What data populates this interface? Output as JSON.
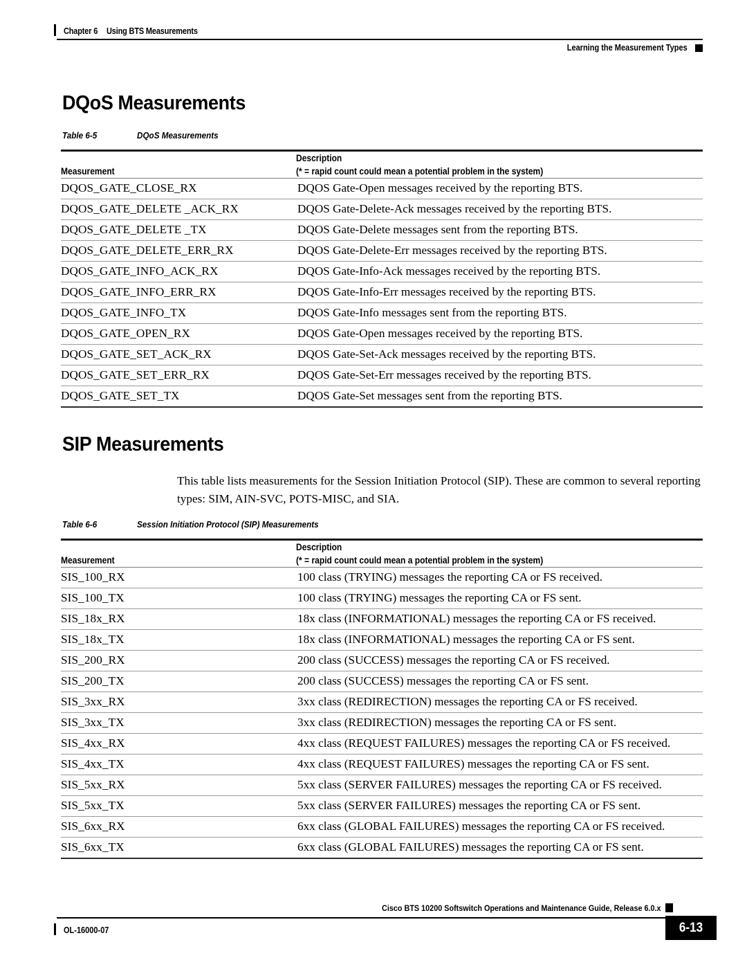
{
  "header": {
    "chapter_label": "Chapter 6",
    "chapter_title": "Using BTS Measurements",
    "right_text": "Learning the Measurement Types"
  },
  "sections": {
    "dqos": {
      "heading": "DQoS Measurements",
      "table": {
        "caption_number": "Table 6-5",
        "caption_title": "DQoS Measurements",
        "columns": {
          "measurement": "Measurement",
          "description_line1": "Description",
          "description_line2": "(* = rapid count could mean a potential problem in the system)"
        },
        "rows": [
          {
            "measurement": "DQOS_GATE_CLOSE_RX",
            "description": "DQOS Gate-Open messages received by the reporting BTS."
          },
          {
            "measurement": "DQOS_GATE_DELETE _ACK_RX",
            "description": "DQOS Gate-Delete-Ack messages received by the reporting BTS."
          },
          {
            "measurement": "DQOS_GATE_DELETE _TX",
            "description": "DQOS Gate-Delete messages sent from the reporting BTS."
          },
          {
            "measurement": "DQOS_GATE_DELETE_ERR_RX",
            "description": "DQOS Gate-Delete-Err messages received by the reporting BTS."
          },
          {
            "measurement": "DQOS_GATE_INFO_ACK_RX",
            "description": "DQOS Gate-Info-Ack messages received by the reporting BTS."
          },
          {
            "measurement": "DQOS_GATE_INFO_ERR_RX",
            "description": "DQOS Gate-Info-Err messages received by the reporting BTS."
          },
          {
            "measurement": "DQOS_GATE_INFO_TX",
            "description": "DQOS Gate-Info messages sent from the reporting BTS."
          },
          {
            "measurement": "DQOS_GATE_OPEN_RX",
            "description": "DQOS Gate-Open messages received by the reporting BTS."
          },
          {
            "measurement": "DQOS_GATE_SET_ACK_RX",
            "description": "DQOS Gate-Set-Ack messages received by the reporting BTS."
          },
          {
            "measurement": "DQOS_GATE_SET_ERR_RX",
            "description": "DQOS Gate-Set-Err messages received by the reporting BTS."
          },
          {
            "measurement": "DQOS_GATE_SET_TX",
            "description": "DQOS Gate-Set messages sent from the reporting BTS."
          }
        ]
      }
    },
    "sip": {
      "heading": "SIP Measurements",
      "intro": "This table lists measurements for the Session Initiation Protocol (SIP). These are common to several reporting types: SIM, AIN-SVC, POTS-MISC, and SIA.",
      "table": {
        "caption_number": "Table 6-6",
        "caption_title": "Session Initiation Protocol (SIP) Measurements",
        "columns": {
          "measurement": "Measurement",
          "description_line1": "Description",
          "description_line2": "(* = rapid count could mean a potential problem in the system)"
        },
        "rows": [
          {
            "measurement": "SIS_100_RX",
            "description": "100 class (TRYING) messages the reporting CA or FS received."
          },
          {
            "measurement": "SIS_100_TX",
            "description": "100 class (TRYING) messages the reporting CA or FS sent."
          },
          {
            "measurement": "SIS_18x_RX",
            "description": "18x class (INFORMATIONAL) messages the reporting CA or FS received."
          },
          {
            "measurement": "SIS_18x_TX",
            "description": "18x class (INFORMATIONAL) messages the reporting CA or FS sent."
          },
          {
            "measurement": "SIS_200_RX",
            "description": "200 class (SUCCESS) messages the reporting CA or FS received."
          },
          {
            "measurement": "SIS_200_TX",
            "description": "200 class (SUCCESS) messages the reporting CA or FS sent."
          },
          {
            "measurement": "SIS_3xx_RX",
            "description": "3xx class (REDIRECTION) messages the reporting CA or FS received."
          },
          {
            "measurement": "SIS_3xx_TX",
            "description": "3xx class (REDIRECTION) messages the reporting CA or FS sent."
          },
          {
            "measurement": "SIS_4xx_RX",
            "description": "4xx class (REQUEST FAILURES) messages the reporting CA or FS received."
          },
          {
            "measurement": "SIS_4xx_TX",
            "description": "4xx class (REQUEST FAILURES) messages the reporting CA or FS sent."
          },
          {
            "measurement": "SIS_5xx_RX",
            "description": "5xx class (SERVER FAILURES) messages the reporting CA or FS received."
          },
          {
            "measurement": "SIS_5xx_TX",
            "description": "5xx class (SERVER FAILURES) messages the reporting CA or FS sent."
          },
          {
            "measurement": "SIS_6xx_RX",
            "description": "6xx class (GLOBAL FAILURES) messages the reporting CA or FS received."
          },
          {
            "measurement": "SIS_6xx_TX",
            "description": "6xx class (GLOBAL FAILURES) messages the reporting CA or FS sent."
          }
        ]
      }
    }
  },
  "footer": {
    "center_text": "Cisco BTS 10200 Softswitch Operations and Maintenance Guide, Release 6.0.x",
    "doc_id": "OL-16000-07",
    "page_number": "6-13"
  },
  "colors": {
    "text": "#000000",
    "rule": "#000000",
    "row_separator": "#9a9a9a",
    "table_top_border": "#1a1a1a",
    "page_background": "#ffffff"
  }
}
